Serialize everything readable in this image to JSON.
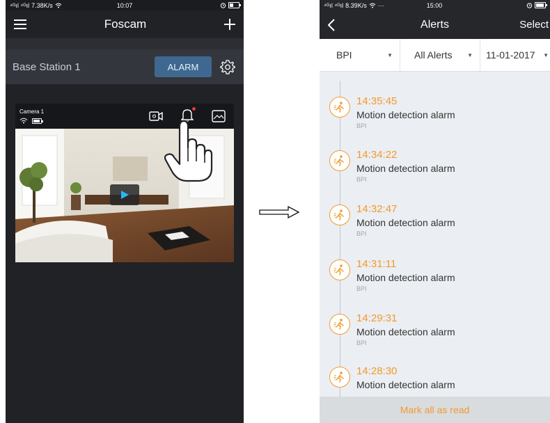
{
  "left": {
    "status": {
      "signal": "⁴ᴳıl ⁴ᴳıl",
      "speed": "7.38K/s",
      "time": "10:07"
    },
    "nav": {
      "title": "Foscam"
    },
    "station": {
      "name": "Base Station 1",
      "alarm_label": "ALARM"
    },
    "camera": {
      "name": "Camera 1",
      "overlay_text": ""
    }
  },
  "right": {
    "status": {
      "signal": "⁴ᴳıl ⁴ᴳıl",
      "speed": "8.39K/s",
      "extra": "···",
      "time": "15:00"
    },
    "nav": {
      "title": "Alerts",
      "select_label": "Select"
    },
    "filters": [
      {
        "label": "BPI"
      },
      {
        "label": "All Alerts"
      },
      {
        "label": "11-01-2017"
      }
    ],
    "alerts": [
      {
        "time": "14:35:45",
        "desc": "Motion detection alarm",
        "source": "BPI"
      },
      {
        "time": "14:34:22",
        "desc": "Motion detection alarm",
        "source": "BPI"
      },
      {
        "time": "14:32:47",
        "desc": "Motion detection alarm",
        "source": "BPI"
      },
      {
        "time": "14:31:11",
        "desc": "Motion detection alarm",
        "source": "BPI"
      },
      {
        "time": "14:29:31",
        "desc": "Motion detection alarm",
        "source": "BPI"
      },
      {
        "time": "14:28:30",
        "desc": "Motion detection alarm",
        "source": ""
      }
    ],
    "mark_all_label": "Mark all as read"
  },
  "colors": {
    "accent": "#f29a2e",
    "alarm_button": "#3f6890",
    "dark_bg": "#202226"
  }
}
